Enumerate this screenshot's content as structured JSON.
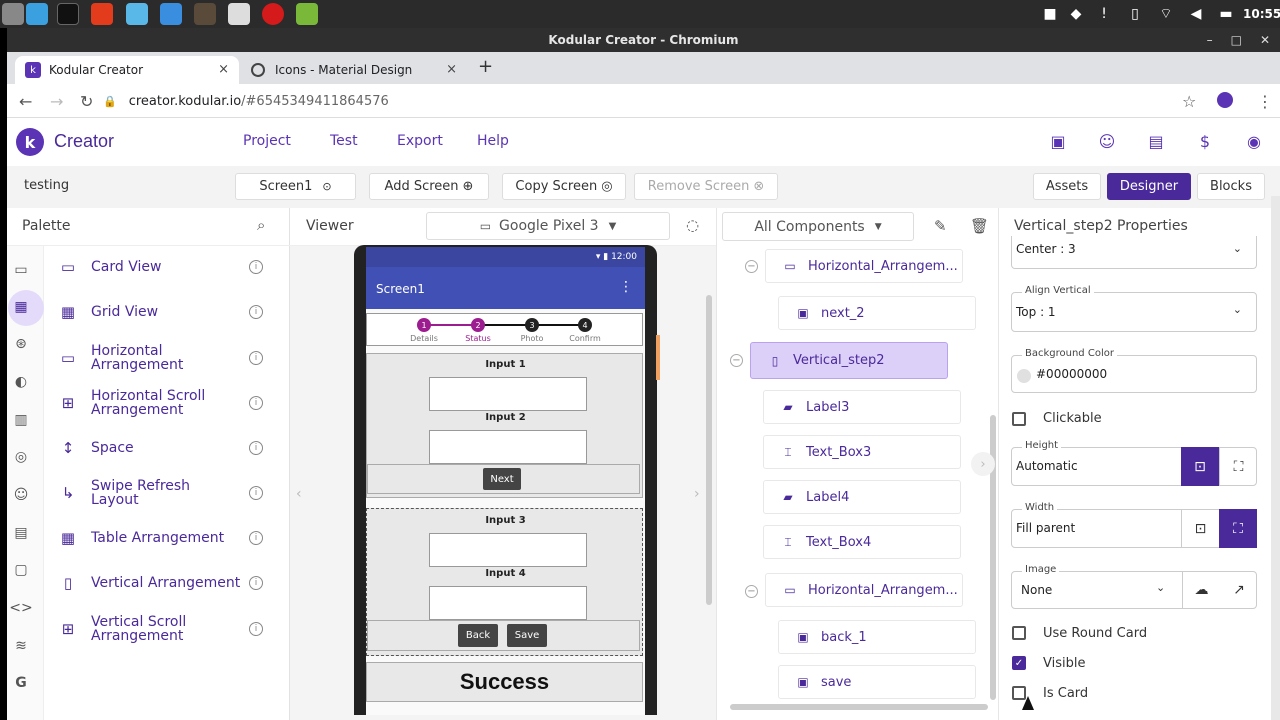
{
  "system": {
    "clock": "10:55"
  },
  "window": {
    "title": "Kodular Creator - Chromium",
    "min": "–",
    "max": "□",
    "close": "✕"
  },
  "tabs": [
    {
      "label": "Kodular Creator",
      "close": "×"
    },
    {
      "label": "Icons - Material Design",
      "close": "×"
    }
  ],
  "newtab": "+",
  "address": {
    "host": "creator.kodular.io",
    "rest": "/#6545349411864576"
  },
  "header": {
    "logo": "k",
    "brand": "Creator",
    "menu": [
      "Project",
      "Test",
      "Export",
      "Help"
    ]
  },
  "toolbar": {
    "project": "testing",
    "screen": "Screen1",
    "add_screen": "Add Screen",
    "copy_screen": "Copy Screen",
    "remove_screen": "Remove Screen",
    "assets": "Assets",
    "designer": "Designer",
    "blocks": "Blocks"
  },
  "palette": {
    "title": "Palette",
    "items": [
      {
        "label": "Card View",
        "icon": "▭"
      },
      {
        "label": "Grid View",
        "icon": "▦"
      },
      {
        "label": "Horizontal Arrangement",
        "icon": "▭"
      },
      {
        "label": "Horizontal Scroll Arrangement",
        "icon": "⊞"
      },
      {
        "label": "Space",
        "icon": "↕"
      },
      {
        "label": "Swipe Refresh Layout",
        "icon": "↳"
      },
      {
        "label": "Table Arrangement",
        "icon": "▦"
      },
      {
        "label": "Vertical Arrangement",
        "icon": "▯"
      },
      {
        "label": "Vertical Scroll Arrangement",
        "icon": "⊞"
      }
    ],
    "info": "i"
  },
  "viewer": {
    "title": "Viewer",
    "device": "Google Pixel 3",
    "status_time": "12:00",
    "app_title": "Screen1",
    "steps": [
      {
        "num": "1",
        "label": "Details"
      },
      {
        "num": "2",
        "label": "Status"
      },
      {
        "num": "3",
        "label": "Photo"
      },
      {
        "num": "4",
        "label": "Confirm"
      }
    ],
    "input1": "Input 1",
    "input2": "Input 2",
    "next": "Next",
    "input3": "Input 3",
    "input4": "Input 4",
    "back": "Back",
    "save": "Save",
    "success": "Success"
  },
  "tree": {
    "filter": "All Components",
    "nodes": [
      {
        "label": "Horizontal_Arrangem...",
        "icon": "▭"
      },
      {
        "label": "next_2",
        "icon": "▣"
      },
      {
        "label": "Vertical_step2",
        "icon": "▯"
      },
      {
        "label": "Label3",
        "icon": "▰"
      },
      {
        "label": "Text_Box3",
        "icon": "⌶"
      },
      {
        "label": "Label4",
        "icon": "▰"
      },
      {
        "label": "Text_Box4",
        "icon": "⌶"
      },
      {
        "label": "Horizontal_Arrangem...",
        "icon": "▭"
      },
      {
        "label": "back_1",
        "icon": "▣"
      },
      {
        "label": "save",
        "icon": "▣"
      }
    ]
  },
  "props": {
    "title": "Vertical_step2 Properties",
    "align_horizontal_value": "Center : 3",
    "align_vertical_label": "Align Vertical",
    "align_vertical_value": "Top : 1",
    "bg_label": "Background Color",
    "bg_value": "#00000000",
    "clickable": "Clickable",
    "height_label": "Height",
    "height_value": "Automatic",
    "width_label": "Width",
    "width_value": "Fill parent",
    "image_label": "Image",
    "image_value": "None",
    "round_card": "Use Round Card",
    "visible": "Visible",
    "is_card": "Is Card"
  },
  "colors": {
    "accent": "#4a2a9a",
    "selected": "#dccff8",
    "appbar": "#4050b5",
    "step_active": "#9c1d8f"
  }
}
